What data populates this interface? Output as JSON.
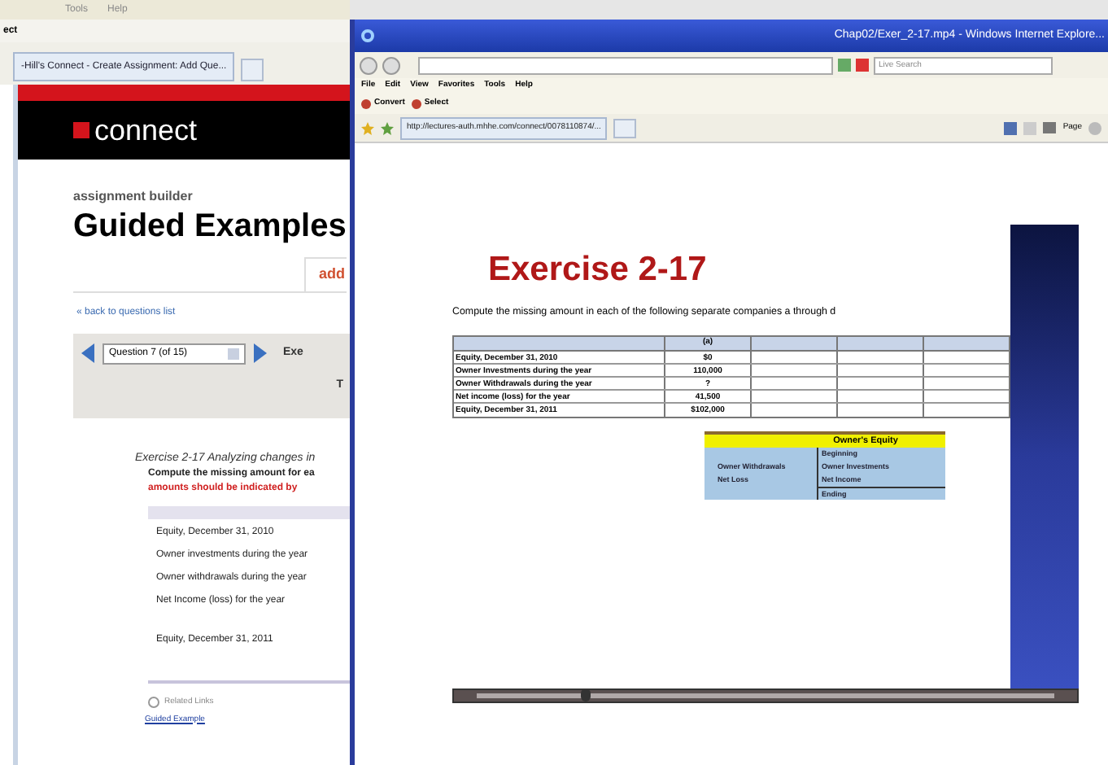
{
  "back_window": {
    "menu": [
      "Tools",
      "Help"
    ],
    "toolbar_text": "ect",
    "tab": "-Hill's Connect - Create Assignment: Add Que...",
    "logo": "connect",
    "subtitle": "assignment builder",
    "title": "Guided Examples",
    "section_tab": "add",
    "back_link": "« back to questions list",
    "question_select": "Question 7 (of 15)",
    "exercise_label": "Exe",
    "letter": "T",
    "exercise_heading": "*Exercise 2-17 Analyzing changes in*",
    "instruction": "Compute the missing amount for ea",
    "instruction_red": "amounts should be indicated by",
    "rows": [
      "Equity, December 31, 2010",
      "Owner investments during the year",
      "Owner withdrawals during the year",
      "Net Income (loss) for the year",
      "Equity, December 31, 2011"
    ],
    "related_links": "Related Links",
    "guided_link": "Guided Example"
  },
  "front_window": {
    "title": "Chap02/Exer_2-17.mp4 - Windows Internet Explore...",
    "search": {
      "placeholder": "Live Search"
    },
    "menu": [
      "File",
      "Edit",
      "View",
      "Favorites",
      "Tools",
      "Help"
    ],
    "toolbar": [
      "Convert",
      "Select"
    ],
    "tab": "http://lectures-auth.mhhe.com/connect/0078110874/...",
    "page_button": "Page",
    "slide": {
      "title": "Exercise 2-17",
      "instruction": "Compute the missing amount in each of the following separate companies a through d",
      "table": {
        "header": "(a)",
        "rows": [
          {
            "label": "Equity, December 31, 2010",
            "value": "$0"
          },
          {
            "label": "Owner Investments during the year",
            "value": "110,000"
          },
          {
            "label": "Owner Withdrawals during the year",
            "value": "?"
          },
          {
            "label": "Net income (loss) for the year",
            "value": "41,500"
          },
          {
            "label": "Equity, December 31, 2011",
            "value": "$102,000"
          }
        ]
      },
      "equity_box": {
        "title": "Owner's Equity",
        "left": [
          "Owner Withdrawals",
          "Net Loss"
        ],
        "right": [
          "Beginning",
          "Owner Investments",
          "Net Income",
          "Ending"
        ]
      }
    },
    "seek_bar": {
      "level": 0.19
    }
  }
}
